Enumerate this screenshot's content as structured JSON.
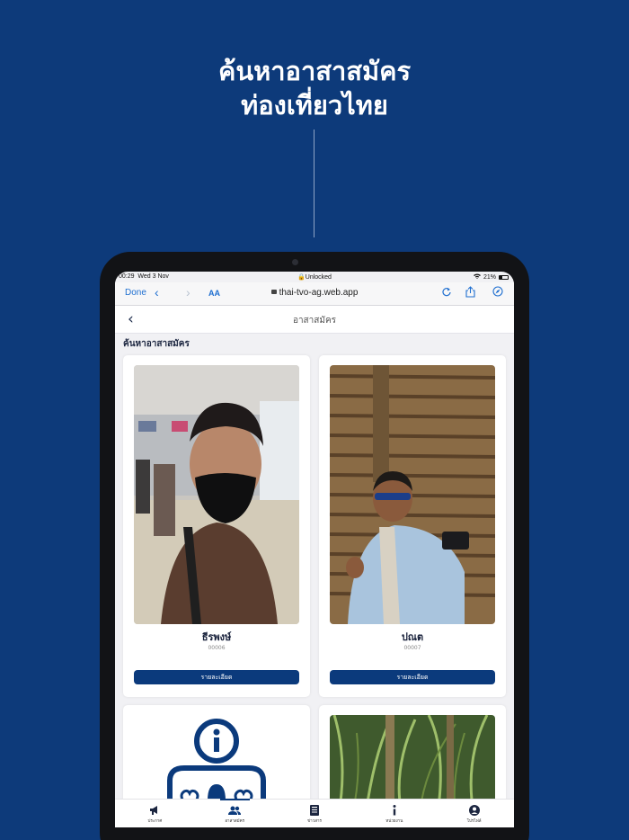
{
  "promo": {
    "title_line1": "ค้นหาอาสาสมัคร",
    "title_line2": "ท่องเที่ยวไทย"
  },
  "status_bar": {
    "time": "00:29",
    "date": "Wed 3 Nov",
    "lock_state": "Unlocked",
    "battery": "21%"
  },
  "browser": {
    "done_label": "Done",
    "text_size_label": "AA",
    "url": "thai-tvo-ag.web.app",
    "icons": [
      "chevron-left-icon",
      "chevron-right-icon",
      "reload-icon",
      "share-icon",
      "compass-icon"
    ]
  },
  "app_header": {
    "title": "อาสาสมัคร"
  },
  "section_title": "ค้นหาอาสาสมัคร",
  "volunteers": [
    {
      "name": "ธีรพงษ์",
      "code": "00006",
      "button": "รายละเอียด"
    },
    {
      "name": "ปณต",
      "code": "00007",
      "button": "รายละเอียด"
    }
  ],
  "tabs": [
    {
      "label": "ประกาศ",
      "icon": "megaphone-icon",
      "active": false
    },
    {
      "label": "อาสาสมัคร",
      "icon": "users-icon",
      "active": true
    },
    {
      "label": "ข่าวสาร",
      "icon": "news-icon",
      "active": false
    },
    {
      "label": "หน่วยงาน",
      "icon": "info-icon",
      "active": false
    },
    {
      "label": "โปรไฟล์",
      "icon": "profile-icon",
      "active": false
    }
  ],
  "colors": {
    "background": "#0d3a7a",
    "accent": "#0b3a7c",
    "link": "#1f6fd0"
  }
}
